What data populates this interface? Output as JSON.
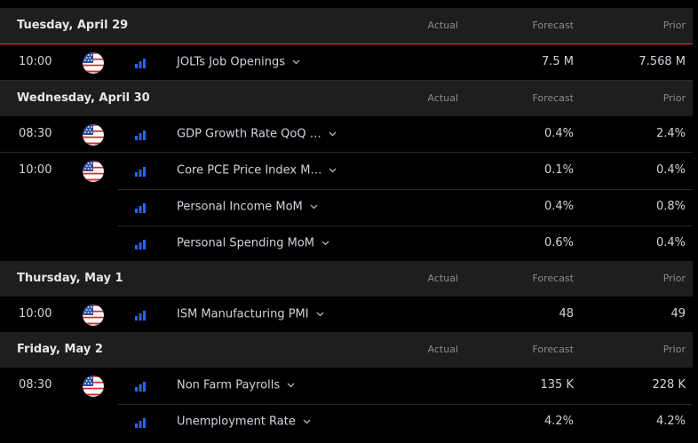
{
  "columns": {
    "actual": "Actual",
    "forecast": "Forecast",
    "prior": "Prior"
  },
  "days": [
    {
      "label": "Tuesday, April 29",
      "events": [
        {
          "time": "10:00",
          "title": "JOLTs Job Openings",
          "actual": "",
          "forecast": "7.5 M",
          "prior": "7.568 M",
          "show_flag": true
        }
      ]
    },
    {
      "label": "Wednesday, April 30",
      "events": [
        {
          "time": "08:30",
          "title": "GDP Growth Rate QoQ …",
          "actual": "",
          "forecast": "0.4%",
          "prior": "2.4%",
          "show_flag": true
        },
        {
          "time": "10:00",
          "title": "Core PCE Price Index M…",
          "actual": "",
          "forecast": "0.1%",
          "prior": "0.4%",
          "show_flag": true
        },
        {
          "time": "",
          "title": "Personal Income MoM",
          "actual": "",
          "forecast": "0.4%",
          "prior": "0.8%",
          "show_flag": false
        },
        {
          "time": "",
          "title": "Personal Spending MoM",
          "actual": "",
          "forecast": "0.6%",
          "prior": "0.4%",
          "show_flag": false
        }
      ]
    },
    {
      "label": "Thursday, May 1",
      "events": [
        {
          "time": "10:00",
          "title": "ISM Manufacturing PMI",
          "actual": "",
          "forecast": "48",
          "prior": "49",
          "show_flag": true
        }
      ]
    },
    {
      "label": "Friday, May 2",
      "events": [
        {
          "time": "08:30",
          "title": "Non Farm Payrolls",
          "actual": "",
          "forecast": "135 K",
          "prior": "228 K",
          "show_flag": true
        },
        {
          "time": "",
          "title": "Unemployment Rate",
          "actual": "",
          "forecast": "4.2%",
          "prior": "4.2%",
          "show_flag": false
        }
      ]
    }
  ],
  "icons": {
    "flag": "us-flag-icon",
    "importance": "importance-bars-icon",
    "expand": "chevron-down-icon"
  },
  "colors": {
    "header_bg": "#1e1e1e",
    "accent_line": "#f23645",
    "importance": "#2962ff"
  }
}
